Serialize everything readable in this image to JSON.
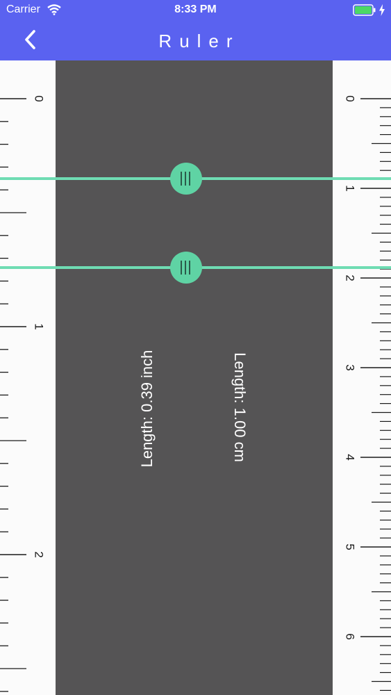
{
  "status_bar": {
    "carrier": "Carrier",
    "time": "8:33 PM",
    "wifi_icon": "wifi-icon",
    "battery_icon": "battery-icon",
    "charging_icon": "charging-bolt-icon"
  },
  "nav": {
    "title": "Ruler",
    "back_icon": "chevron-left-icon"
  },
  "ruler": {
    "left_unit_labels": [
      "0",
      "1",
      "2"
    ],
    "right_unit_labels": [
      "0",
      "1",
      "2",
      "3",
      "4",
      "5",
      "6"
    ]
  },
  "measurement": {
    "inch_label": "Length: 0.39 inch",
    "cm_label": "Length: 1.00 cm"
  },
  "colors": {
    "header": "#5a62f0",
    "measure_area": "#555455",
    "accent": "#5fd3a4"
  }
}
